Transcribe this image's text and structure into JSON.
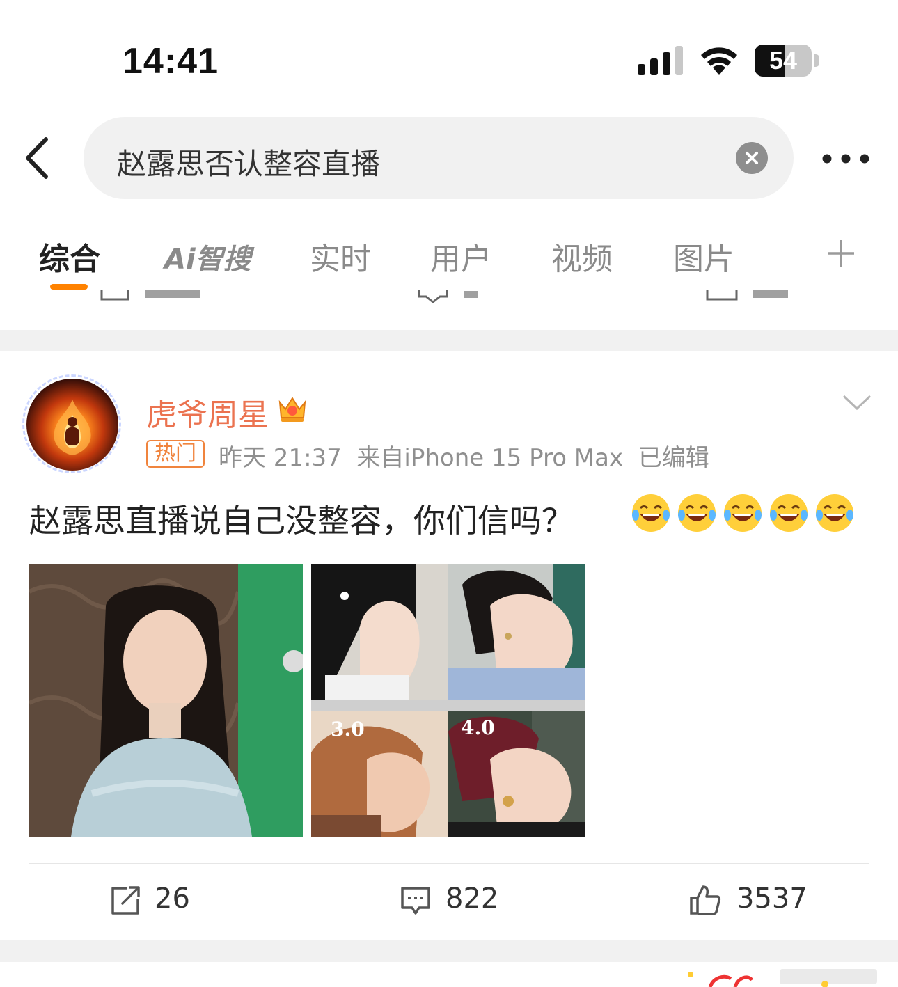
{
  "status_bar": {
    "time": "14:41",
    "battery_percent": "54",
    "battery_level": 0.54
  },
  "search": {
    "query": "赵露思否认整容直播"
  },
  "tabs": [
    {
      "label": "综合",
      "active": true
    },
    {
      "label": "Ai智搜",
      "active": false
    },
    {
      "label": "实时",
      "active": false
    },
    {
      "label": "用户",
      "active": false
    },
    {
      "label": "视频",
      "active": false
    },
    {
      "label": "图片",
      "active": false
    }
  ],
  "post": {
    "username": "虎爷周星",
    "badge": "热门",
    "time": "昨天 21:37",
    "source": "来自iPhone 15 Pro Max",
    "edited": "已编辑",
    "text": "赵露思直播说自己没整容，你们信吗？",
    "emoji_count": 5,
    "images": [
      {
        "label": ""
      },
      {
        "labels": [
          "3.0",
          "4.0"
        ]
      }
    ],
    "actions": {
      "repost_count": "26",
      "comment_count": "822",
      "like_count": "3537"
    }
  },
  "colors": {
    "accent": "#ff8200",
    "username": "#eb7350",
    "badge": "#f0843d",
    "muted": "#8f8f8f"
  }
}
